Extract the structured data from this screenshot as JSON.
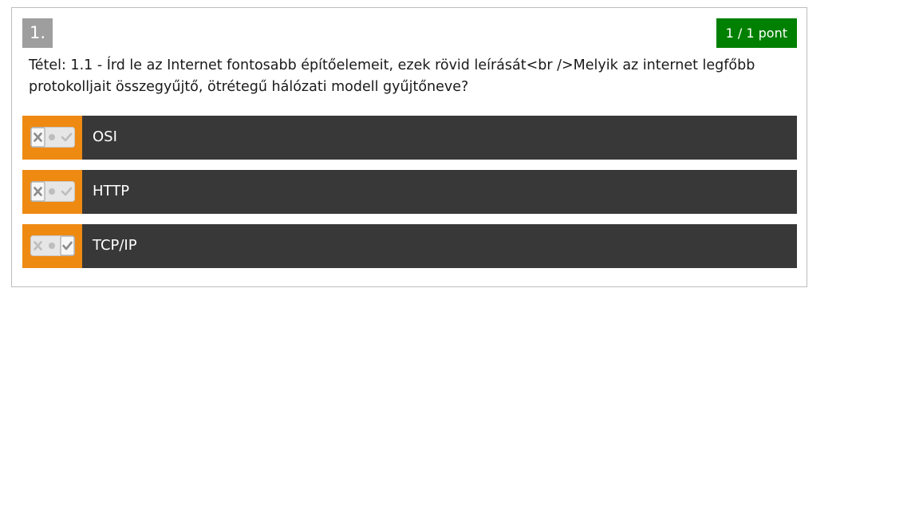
{
  "question": {
    "number": "1.",
    "score": "1 / 1 pont",
    "text": "Tétel: 1.1 - Írd le az Internet fontosabb építőelemeit, ezek rövid leírását<br />Melyik az internet legfőbb protokolljait összegyűjtő, ötrétegű hálózati modell gyűjtőneve?"
  },
  "answers": [
    {
      "label": "OSI",
      "toggle_state": "false",
      "toggle_icon": "tristate-toggle-icon"
    },
    {
      "label": "HTTP",
      "toggle_state": "false",
      "toggle_icon": "tristate-toggle-icon"
    },
    {
      "label": "TCP/IP",
      "toggle_state": "true",
      "toggle_icon": "tristate-toggle-icon"
    }
  ],
  "colors": {
    "score_bg": "#008000",
    "number_bg": "#9e9e9e",
    "toggle_bg": "#ee8a12",
    "answer_bg": "#383838"
  }
}
